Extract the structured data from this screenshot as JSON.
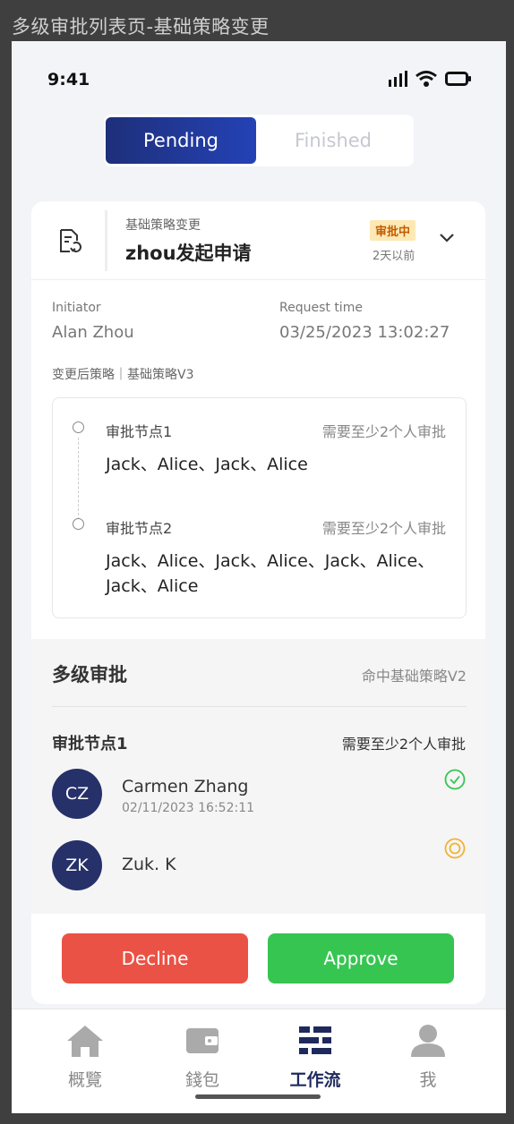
{
  "frame_title": "多级审批列表页-基础策略变更",
  "status_bar": {
    "time": "9:41"
  },
  "segment": {
    "pending": "Pending",
    "finished": "Finished"
  },
  "request": {
    "subtype": "基础策略变更",
    "title": "zhou发起申请",
    "badge": "审批中",
    "ago": "2天以前",
    "initiator_label": "Initiator",
    "initiator": "Alan Zhou",
    "time_label": "Request time",
    "time": "03/25/2023 13:02:27",
    "policy": "变更后策略｜基础策略V3",
    "nodes": [
      {
        "name": "审批节点1",
        "req": "需要至少2个人审批",
        "approvers": "Jack、Alice、Jack、Alice"
      },
      {
        "name": "审批节点2",
        "req": "需要至少2个人审批",
        "approvers_line1": "Jack、Alice、Jack、Alice、Jack、Alice、",
        "approvers_line2": "Jack、Alice"
      }
    ]
  },
  "multi": {
    "title": "多级审批",
    "hit": "命中基础策略V2",
    "node_name": "审批节点1",
    "node_req": "需要至少2个人审批",
    "people": [
      {
        "initials": "CZ",
        "name": "Carmen Zhang",
        "date": "02/11/2023 16:52:11",
        "status": "approved",
        "status_color": "#37c552"
      },
      {
        "initials": "ZK",
        "name": "Zuk. K",
        "date": "",
        "status": "pending",
        "status_color": "#f2b233"
      }
    ]
  },
  "actions": {
    "decline": "Decline",
    "approve": "Approve",
    "decline_color": "#ea5245",
    "approve_color": "#37c552"
  },
  "tabbar": {
    "items": [
      {
        "label": "概覽",
        "icon": "home-icon"
      },
      {
        "label": "錢包",
        "icon": "wallet-icon"
      },
      {
        "label": "工作流",
        "icon": "workflow-icon",
        "active": true
      },
      {
        "label": "我",
        "icon": "user-icon"
      }
    ]
  },
  "colors": {
    "accent": "#1e2f7a",
    "avatar": "#26316a"
  }
}
